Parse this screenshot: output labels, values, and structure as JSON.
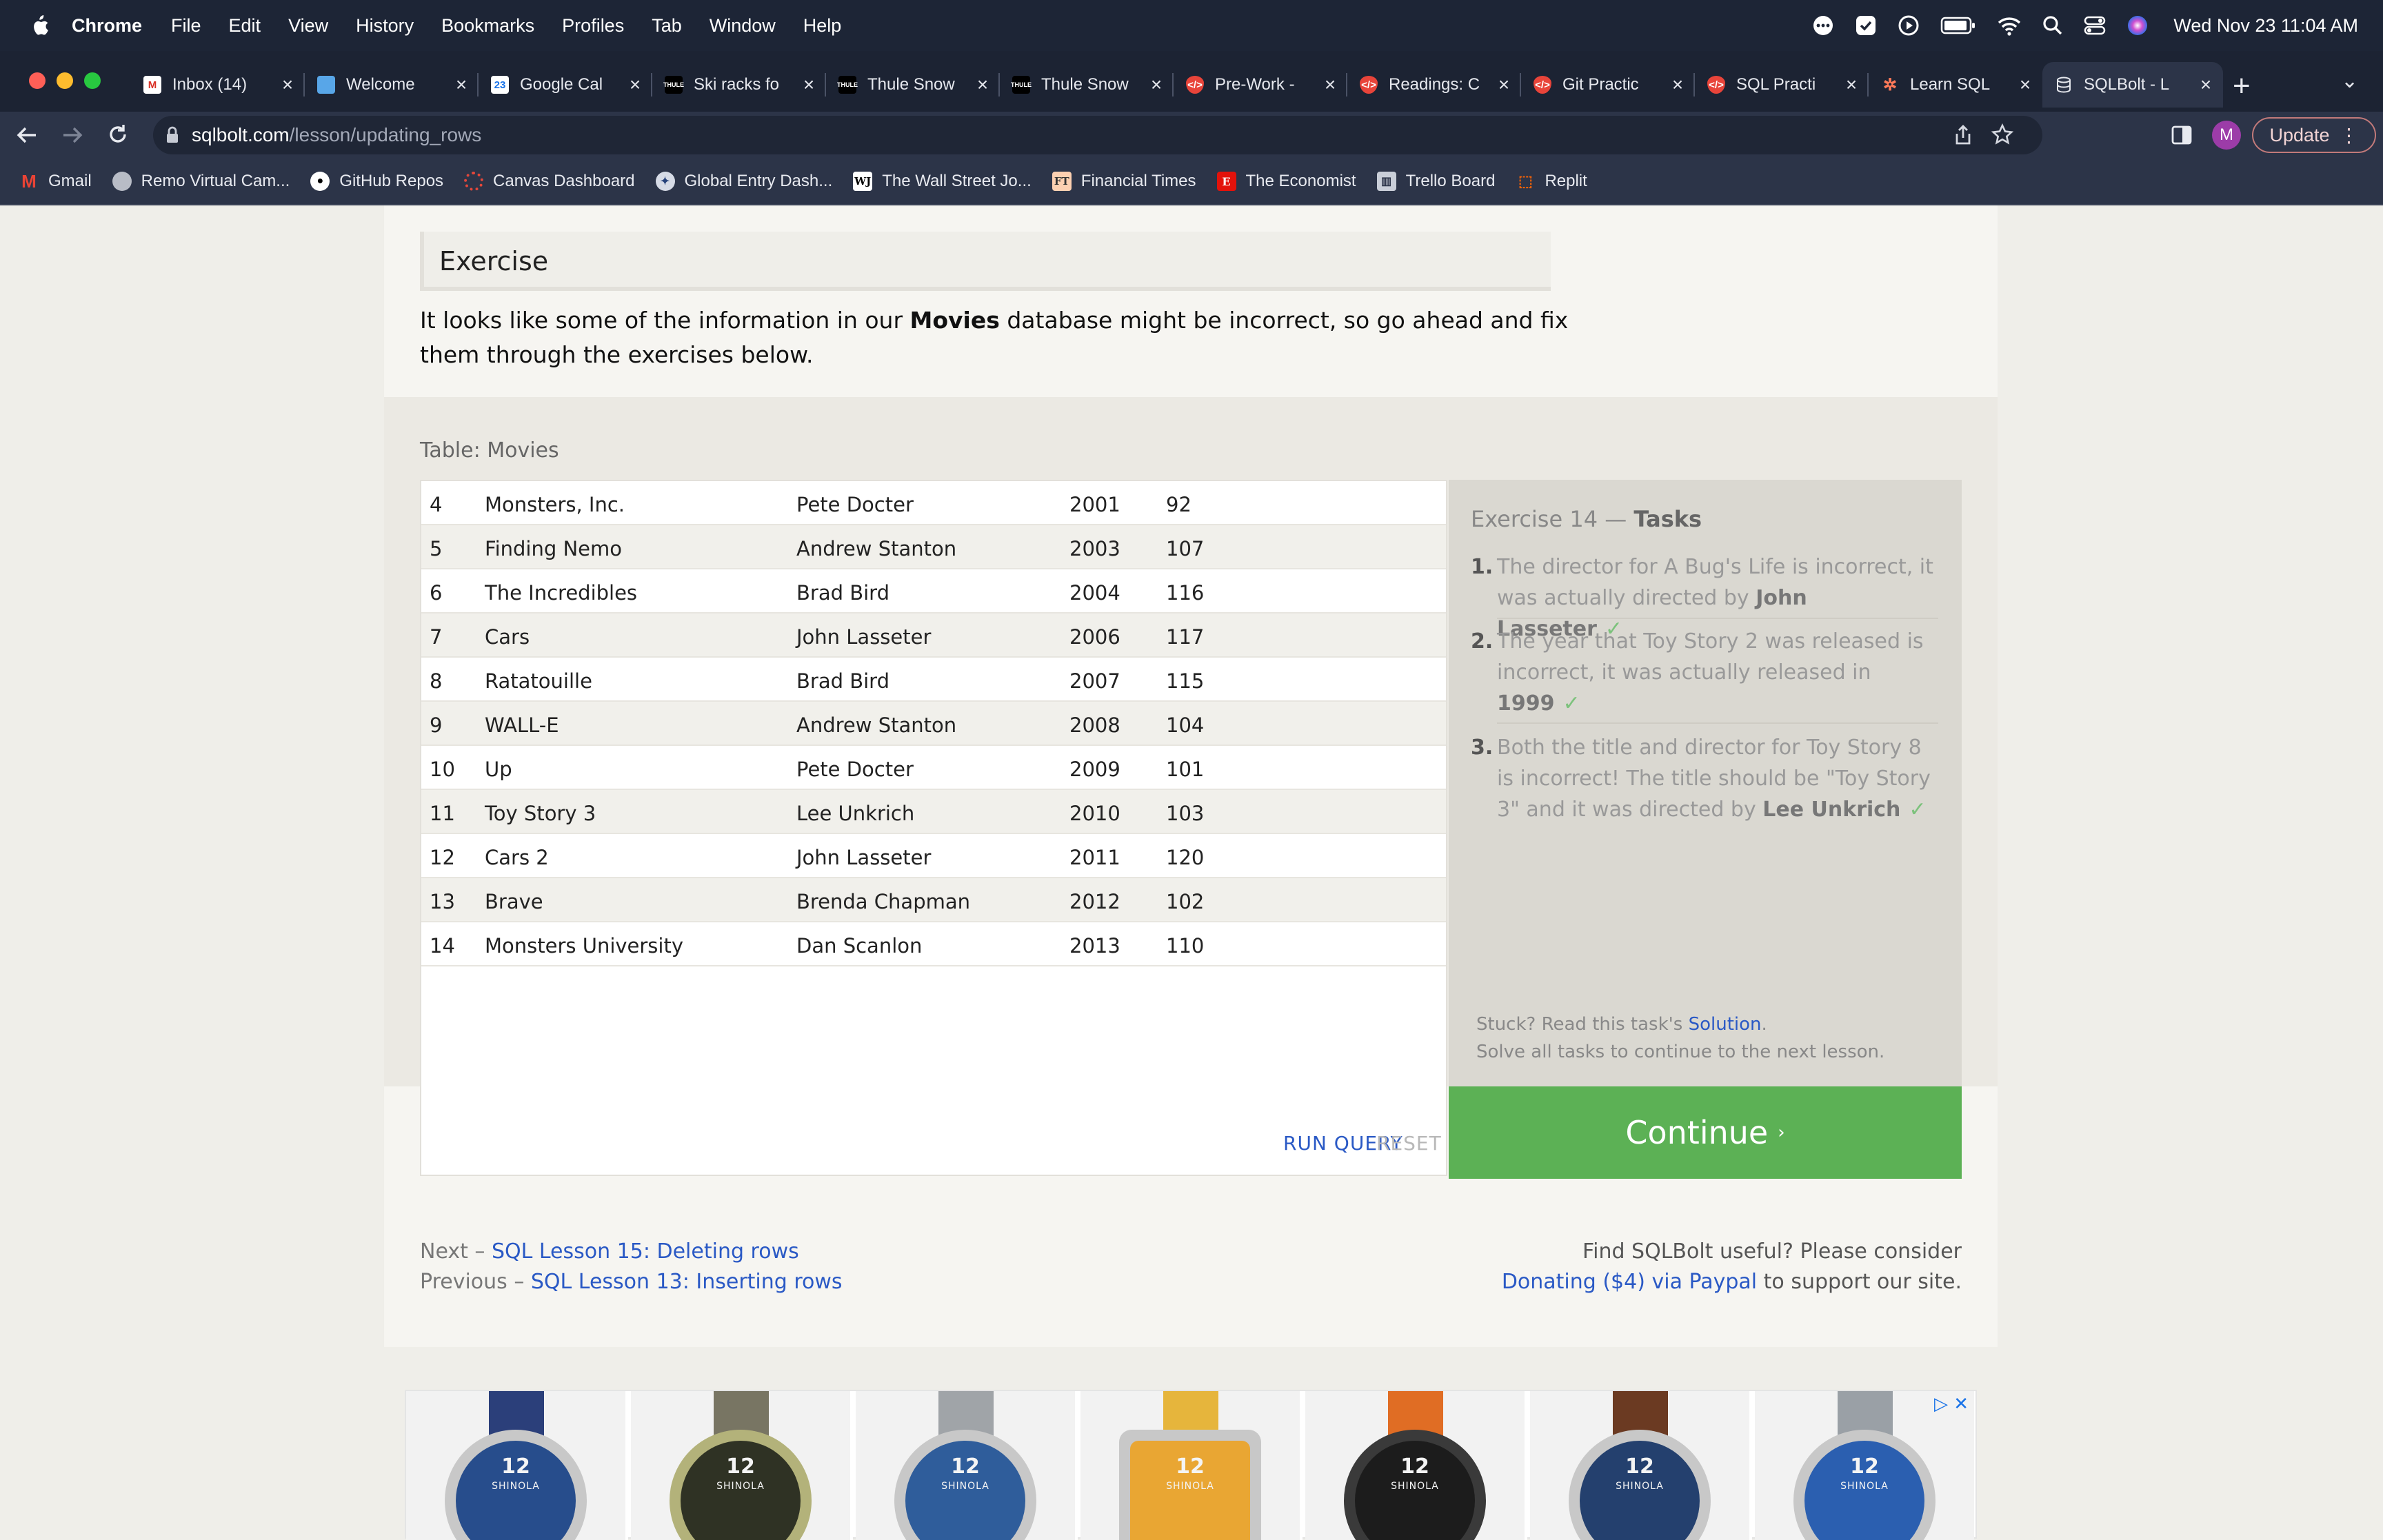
{
  "menubar": {
    "app": "Chrome",
    "items": [
      "File",
      "Edit",
      "View",
      "History",
      "Bookmarks",
      "Profiles",
      "Tab",
      "Window",
      "Help"
    ],
    "clock": "Wed Nov 23  11:04 AM"
  },
  "tabs": [
    {
      "title": "Inbox (14)",
      "icon": "gmail-icon"
    },
    {
      "title": "Welcome",
      "icon": "doc-icon"
    },
    {
      "title": "Google Cal",
      "icon": "calendar-icon"
    },
    {
      "title": "Ski racks fo",
      "icon": "thule-icon"
    },
    {
      "title": "Thule Snow",
      "icon": "thule-icon"
    },
    {
      "title": "Thule Snow",
      "icon": "thule-icon"
    },
    {
      "title": "Pre-Work -",
      "icon": "shield-icon"
    },
    {
      "title": "Readings: C",
      "icon": "shield-icon"
    },
    {
      "title": "Git Practic",
      "icon": "shield-icon"
    },
    {
      "title": "SQL Practi",
      "icon": "shield-icon"
    },
    {
      "title": "Learn SQL",
      "icon": "hubspot-icon"
    },
    {
      "title": "SQLBolt - L",
      "icon": "database-icon"
    }
  ],
  "address": {
    "host": "sqlbolt.com",
    "path": "/lesson/updating_rows"
  },
  "toolbar": {
    "profile_initial": "M",
    "update_label": "Update"
  },
  "bookmarks": [
    {
      "label": "Gmail",
      "icon": "gmail-icon"
    },
    {
      "label": "Remo Virtual Cam...",
      "icon": "globe-icon"
    },
    {
      "label": "GitHub Repos",
      "icon": "github-icon"
    },
    {
      "label": "Canvas Dashboard",
      "icon": "canvas-icon"
    },
    {
      "label": "Global Entry Dash...",
      "icon": "seal-icon"
    },
    {
      "label": "The Wall Street Jo...",
      "icon": "wsj-icon"
    },
    {
      "label": "Financial Times",
      "icon": "ft-icon"
    },
    {
      "label": "The Economist",
      "icon": "economist-icon"
    },
    {
      "label": "Trello Board",
      "icon": "trello-icon"
    },
    {
      "label": "Replit",
      "icon": "replit-icon"
    }
  ],
  "exercise": {
    "heading": "Exercise",
    "intro_before": "It looks like some of the information in our ",
    "intro_bold": "Movies",
    "intro_after": " database might be incorrect, so go ahead and fix them through the exercises below.",
    "table_label": "Table: Movies"
  },
  "movies": [
    {
      "id": "4",
      "title": "Monsters, Inc.",
      "director": "Pete Docter",
      "year": "2001",
      "length": "92"
    },
    {
      "id": "5",
      "title": "Finding Nemo",
      "director": "Andrew Stanton",
      "year": "2003",
      "length": "107"
    },
    {
      "id": "6",
      "title": "The Incredibles",
      "director": "Brad Bird",
      "year": "2004",
      "length": "116"
    },
    {
      "id": "7",
      "title": "Cars",
      "director": "John Lasseter",
      "year": "2006",
      "length": "117"
    },
    {
      "id": "8",
      "title": "Ratatouille",
      "director": "Brad Bird",
      "year": "2007",
      "length": "115"
    },
    {
      "id": "9",
      "title": "WALL-E",
      "director": "Andrew Stanton",
      "year": "2008",
      "length": "104"
    },
    {
      "id": "10",
      "title": "Up",
      "director": "Pete Docter",
      "year": "2009",
      "length": "101"
    },
    {
      "id": "11",
      "title": "Toy Story 3",
      "director": "Lee Unkrich",
      "year": "2010",
      "length": "103"
    },
    {
      "id": "12",
      "title": "Cars 2",
      "director": "John Lasseter",
      "year": "2011",
      "length": "120"
    },
    {
      "id": "13",
      "title": "Brave",
      "director": "Brenda Chapman",
      "year": "2012",
      "length": "102"
    },
    {
      "id": "14",
      "title": "Monsters University",
      "director": "Dan Scanlon",
      "year": "2013",
      "length": "110"
    }
  ],
  "actions": {
    "run": "RUN QUERY",
    "reset": "RESET"
  },
  "tasks": {
    "title_prefix": "Exercise 14 — ",
    "title_bold": "Tasks",
    "items": [
      {
        "num": "1.",
        "text": "The director for A Bug's Life is incorrect, it was actually directed by ",
        "bold": "John Lasseter",
        "check": "✓"
      },
      {
        "num": "2.",
        "text": "The year that Toy Story 2 was released is incorrect, it was actually released in ",
        "bold": "1999",
        "check": "✓"
      },
      {
        "num": "3.",
        "text": "Both the title and director for Toy Story 8 is incorrect! The title should be \"Toy Story 3\" and it was directed by ",
        "bold": "Lee Unkrich",
        "check": "✓"
      }
    ],
    "stuck_prefix": "Stuck? Read this task's ",
    "stuck_link": "Solution",
    "stuck_suffix": ".",
    "solve_all": "Solve all tasks to continue to the next lesson.",
    "continue": "Continue",
    "continue_arrow": "›"
  },
  "footer": {
    "next_prefix": "Next – ",
    "next_link": "SQL Lesson 15: Deleting rows",
    "prev_prefix": "Previous – ",
    "prev_link": "SQL Lesson 13: Inserting rows",
    "support_line1": "Find SQLBolt useful? Please consider",
    "support_link": "Donating ($4) via Paypal",
    "support_suffix": " to support our site."
  },
  "ad": {
    "brand": "SHINOLA",
    "dial_number": "12",
    "icons": "▷ ✕",
    "watches": [
      {
        "dial": "#274d8c",
        "band": "#2b3f7a"
      },
      {
        "dial": "#2f3224",
        "band": "#787563"
      },
      {
        "dial": "#2f5d9b",
        "band": "#a0a4a8"
      },
      {
        "dial": "#e9a633",
        "band": "#e6b53c"
      },
      {
        "dial": "#1c1c1c",
        "band": "#e06d24"
      },
      {
        "dial": "#24406e",
        "band": "#6b3a22"
      },
      {
        "dial": "#2b5fb0",
        "band": "#9aa0a6"
      }
    ]
  }
}
